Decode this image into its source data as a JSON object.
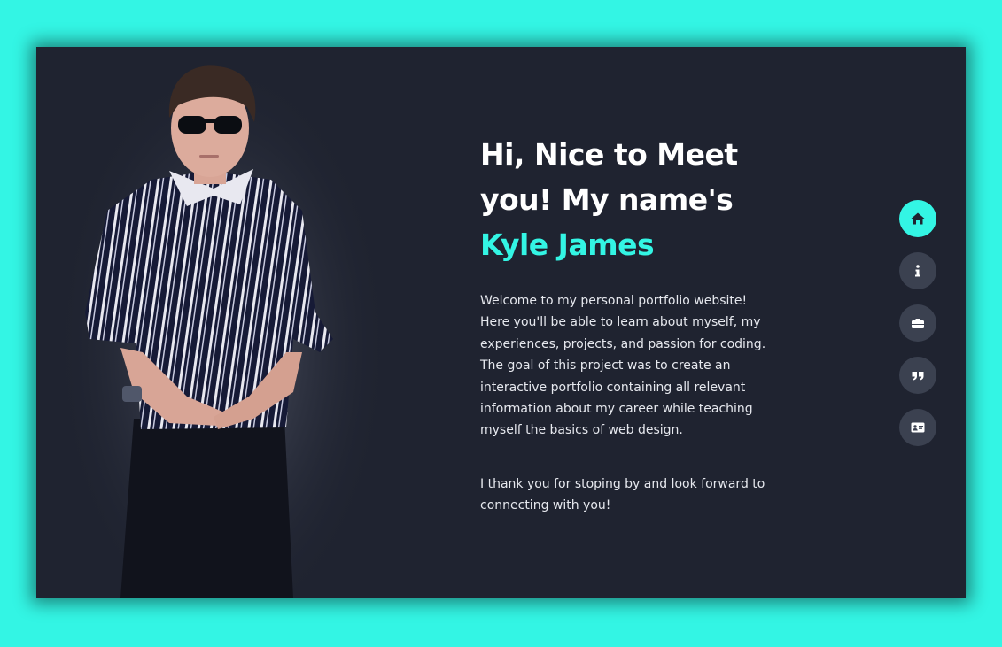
{
  "hero": {
    "heading_line1": "Hi, Nice to Meet",
    "heading_line2": "you! My name's",
    "name": "Kyle James",
    "paragraph1": "Welcome to my personal portfolio website! Here you'll be able to learn about myself, my experiences, projects, and passion for coding. The goal of this project was to create an interactive portfolio containing all relevant information about my career while teaching myself the basics of web design.",
    "paragraph2": "I thank you for stoping by and look forward to connecting with you!"
  },
  "nav": {
    "items": [
      {
        "icon": "home-icon",
        "active": true
      },
      {
        "icon": "info-icon",
        "active": false
      },
      {
        "icon": "briefcase-icon",
        "active": false
      },
      {
        "icon": "quote-icon",
        "active": false
      },
      {
        "icon": "contact-card-icon",
        "active": false
      }
    ]
  },
  "colors": {
    "accent": "#33f5e4",
    "panel": "#1f2330",
    "nav_button": "#3b4150",
    "text": "#ffffff"
  }
}
